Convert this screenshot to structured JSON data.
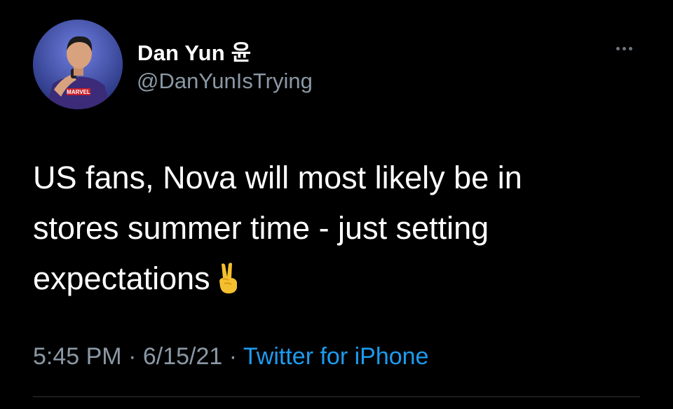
{
  "author": {
    "display_name": "Dan Yun 윤",
    "handle": "@DanYunIsTrying",
    "avatar_shirt_text": "MARVEL"
  },
  "tweet": {
    "lines": [
      "US fans, Nova will most likely be in",
      "stores summer time - just setting",
      "expectations"
    ],
    "emoji": "victory-hand-emoji"
  },
  "meta": {
    "time": "5:45 PM",
    "separator": " · ",
    "date": "6/15/21",
    "source": "Twitter for iPhone"
  },
  "icons": {
    "more": "more-options-icon"
  },
  "colors": {
    "background": "#000000",
    "text": "#ffffff",
    "secondary": "#8b98a5",
    "link": "#1d9bf0"
  }
}
